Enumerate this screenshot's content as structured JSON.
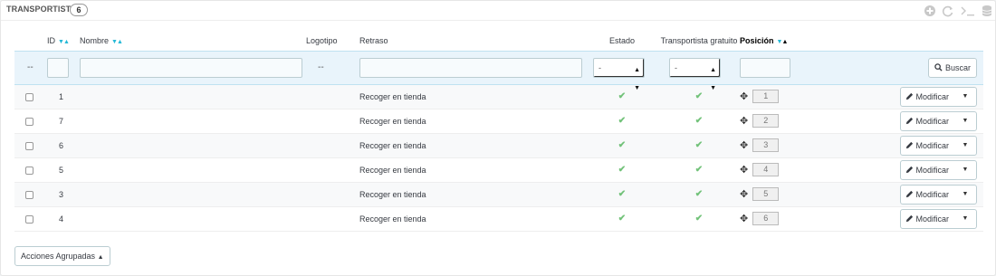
{
  "header": {
    "title": "TRANSPORTISTAS",
    "count": "6",
    "tools": [
      "add-icon",
      "refresh-icon",
      "sql-icon",
      "database-icon"
    ]
  },
  "columns": {
    "id": "ID",
    "nombre": "Nombre",
    "logotipo": "Logotipo",
    "retraso": "Retraso",
    "estado": "Estado",
    "gratuito": "Transportista gratuito",
    "posicion": "Posición"
  },
  "filters": {
    "dash": "--",
    "estado_value": "-",
    "gratuito_value": "-",
    "search_button": "Buscar"
  },
  "rows": [
    {
      "id": "1",
      "retraso": "Recoger en tienda",
      "position": "1",
      "action": "Modificar"
    },
    {
      "id": "7",
      "retraso": "Recoger en tienda",
      "position": "2",
      "action": "Modificar"
    },
    {
      "id": "6",
      "retraso": "Recoger en tienda",
      "position": "3",
      "action": "Modificar"
    },
    {
      "id": "5",
      "retraso": "Recoger en tienda",
      "position": "4",
      "action": "Modificar"
    },
    {
      "id": "3",
      "retraso": "Recoger en tienda",
      "position": "5",
      "action": "Modificar"
    },
    {
      "id": "4",
      "retraso": "Recoger en tienda",
      "position": "6",
      "action": "Modificar"
    }
  ],
  "bulk_actions": "Acciones Agrupadas",
  "colors": {
    "accent": "#25b9d7",
    "check": "#72c279",
    "filter_bg": "#e9f4fb"
  }
}
